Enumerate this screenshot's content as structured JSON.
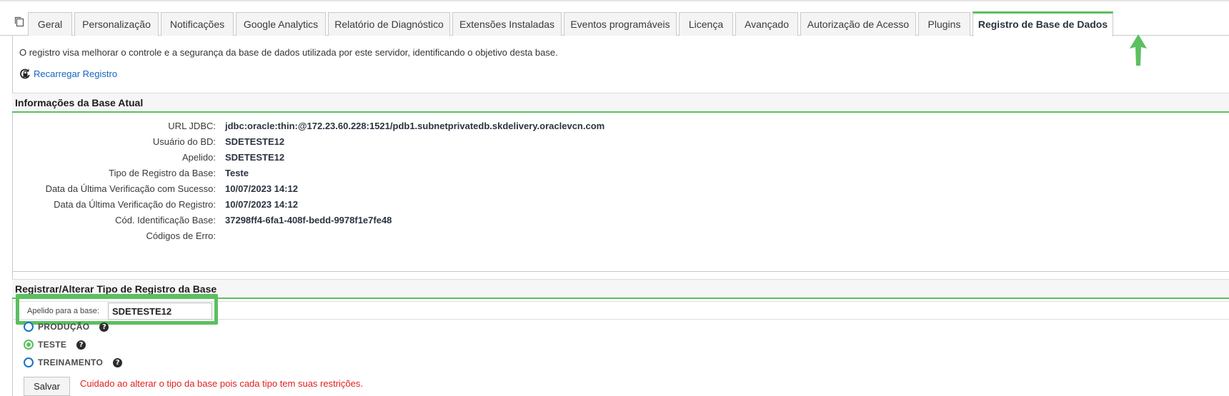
{
  "tabs": [
    {
      "label": "Geral",
      "active": false
    },
    {
      "label": "Personalização",
      "active": false
    },
    {
      "label": "Notificações",
      "active": false
    },
    {
      "label": "Google Analytics",
      "active": false
    },
    {
      "label": "Relatório de Diagnóstico",
      "active": false
    },
    {
      "label": "Extensões Instaladas",
      "active": false
    },
    {
      "label": "Eventos programáveis",
      "active": false
    },
    {
      "label": "Licença",
      "active": false
    },
    {
      "label": "Avançado",
      "active": false
    },
    {
      "label": "Autorização de Acesso",
      "active": false
    },
    {
      "label": "Plugins",
      "active": false
    },
    {
      "label": "Registro de Base de Dados",
      "active": true
    }
  ],
  "intro_text": "O registro visa melhorar o controle e a segurança da base de dados utilizada por este servidor, identificando o objetivo desta base.",
  "reload_link": "Recarregar Registro",
  "current_info": {
    "title": "Informações da Base Atual",
    "rows": [
      {
        "label": "URL JDBC:",
        "value": "jdbc:oracle:thin:@172.23.60.228:1521/pdb1.subnetprivatedb.skdelivery.oraclevcn.com"
      },
      {
        "label": "Usuário do BD:",
        "value": "SDETESTE12"
      },
      {
        "label": "Apelido:",
        "value": "SDETESTE12"
      },
      {
        "label": "Tipo de Registro da Base:",
        "value": "Teste"
      },
      {
        "label": "Data da Última Verificação com Sucesso:",
        "value": "10/07/2023 14:12"
      },
      {
        "label": "Data da Última Verificação do Registro:",
        "value": "10/07/2023 14:12"
      },
      {
        "label": "Cód. Identificação Base:",
        "value": "37298ff4-6fa1-408f-bedd-9978f1e7fe48"
      },
      {
        "label": "Códigos de Erro:",
        "value": ""
      }
    ]
  },
  "register_form": {
    "title": "Registrar/Alterar Tipo de Registro da Base",
    "alias_label": "Apelido para a base:",
    "alias_value": "SDETESTE12",
    "options": [
      {
        "label": "PRODUÇÃO",
        "checked": false
      },
      {
        "label": "TESTE",
        "checked": true
      },
      {
        "label": "TREINAMENTO",
        "checked": false
      }
    ],
    "help_glyph": "?",
    "save_label": "Salvar",
    "warning": "Cuidado ao alterar o tipo da base pois cada tipo tem suas restrições."
  },
  "colors": {
    "accent_green": "#5cbf60",
    "link_blue": "#1565c0",
    "warning_red": "#e01e1e"
  },
  "icons": [
    "copy-icon",
    "reload-lock-icon",
    "help-icon",
    "up-arrow-annotation-icon"
  ]
}
